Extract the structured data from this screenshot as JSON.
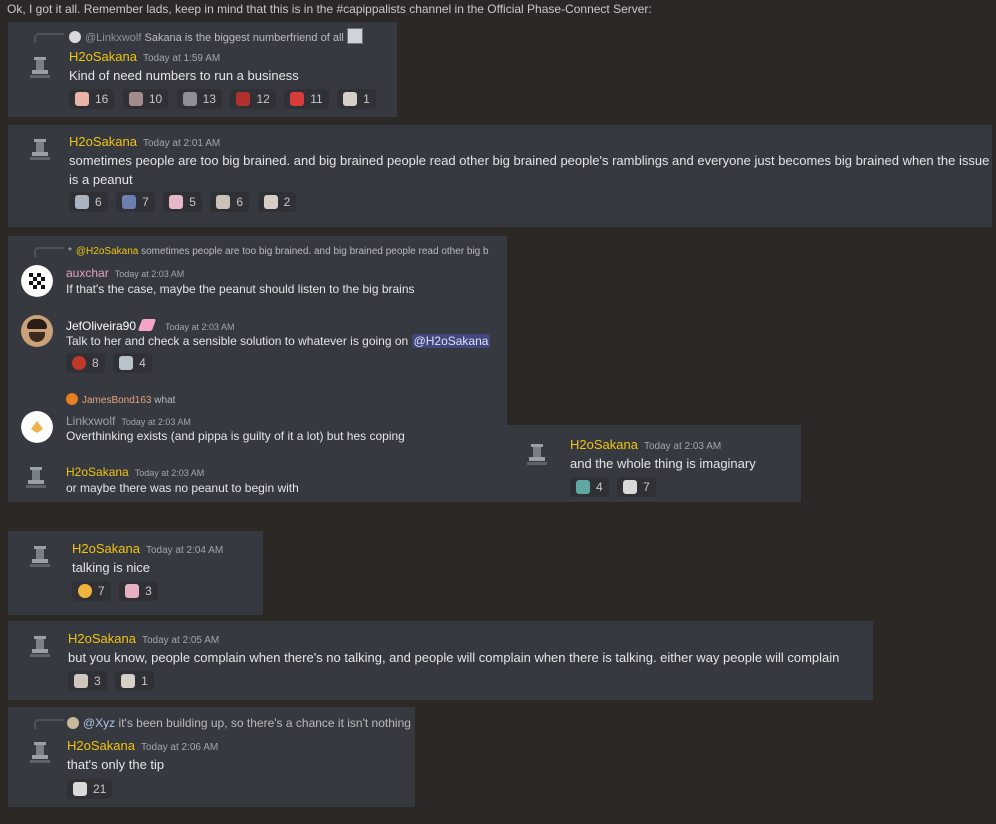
{
  "header_text": "Ok, I got it all. Remember lads, keep in mind that this is in the #capippalists channel in the Official Phase-Connect Server:",
  "msg1": {
    "reply_user": "@Linkxwolf",
    "reply_text": "Sakana is the biggest numberfriend of all",
    "author": "H2oSakana",
    "time": "Today at 1:59 AM",
    "text": "Kind of need numbers to run a business",
    "reactions": [
      "16",
      "10",
      "13",
      "12",
      "11",
      "1"
    ]
  },
  "msg2": {
    "author": "H2oSakana",
    "time": "Today at 2:01 AM",
    "text_line1": "sometimes people are too big brained. and big brained people read other big brained people's ramblings and everyone just becomes big brained when the issue",
    "text_line2": "is a peanut",
    "reactions": [
      "6",
      "7",
      "5",
      "6",
      "2"
    ]
  },
  "thread": {
    "reply1_user": "@H2oSakana",
    "reply1_text": "sometimes people are too big brained. and big brained people read other big b",
    "m1_author": "auxchar",
    "m1_time": "Today at 2:03 AM",
    "m1_text": "If that's the case, maybe the peanut should listen to the big brains",
    "m2_author": "JefOliveira90",
    "m2_time": "Today at 2:03 AM",
    "m2_text": "Talk to her and check a sensible solution to whatever is going on",
    "m2_mention": "@H2oSakana",
    "m2_reactions": [
      "8",
      "4"
    ],
    "reply3_user": "JamesBond163",
    "reply3_text": "what",
    "m3_author": "Linkxwolf",
    "m3_time": "Today at 2:03 AM",
    "m3_text": "Overthinking exists (and pippa is guilty of it a lot) but hes coping",
    "m4_author": "H2oSakana",
    "m4_time": "Today at 2:03 AM",
    "m4_text": "or maybe there was no peanut to begin with"
  },
  "msg_side": {
    "author": "H2oSakana",
    "time": "Today at 2:03 AM",
    "text": "and the whole thing is imaginary",
    "reactions": [
      "4",
      "7"
    ]
  },
  "msg4": {
    "author": "H2oSakana",
    "time": "Today at 2:04 AM",
    "text": "talking is nice",
    "reactions": [
      "7",
      "3"
    ]
  },
  "msg5": {
    "author": "H2oSakana",
    "time": "Today at 2:05 AM",
    "text": "but you know, people complain when there's no talking, and people will complain when there is talking. either way people will complain",
    "reactions": [
      "3",
      "1"
    ]
  },
  "msg6": {
    "reply_user": "@Xyz",
    "reply_text": "it's been building up, so there's a chance it isn't nothing",
    "author": "H2oSakana",
    "time": "Today at 2:06 AM",
    "text": "that's only the tip",
    "reactions": [
      "21"
    ]
  },
  "colors": {
    "background": "#2c2825",
    "card": "#36393f",
    "username_gold": "#f1c40f",
    "mention": "#5865f2"
  }
}
